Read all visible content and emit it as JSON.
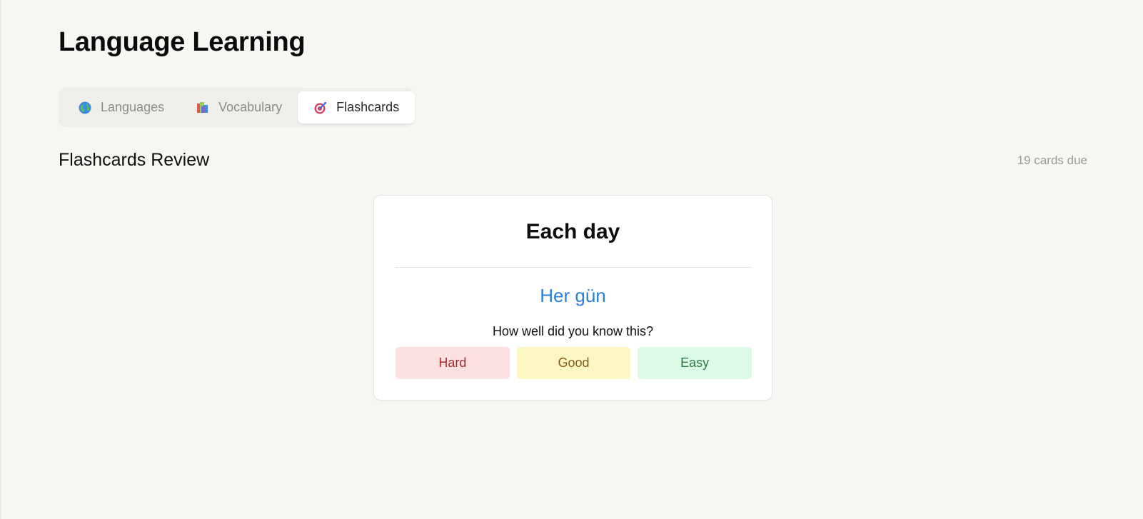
{
  "app": {
    "title": "Language Learning"
  },
  "tabs": [
    {
      "label": "Languages",
      "icon": "globe-icon",
      "active": false
    },
    {
      "label": "Vocabulary",
      "icon": "books-icon",
      "active": false
    },
    {
      "label": "Flashcards",
      "icon": "target-icon",
      "active": true
    }
  ],
  "review": {
    "title": "Flashcards Review",
    "due_text": "19 cards due"
  },
  "card": {
    "front": "Each day",
    "back": "Her gün",
    "prompt": "How well did you know this?"
  },
  "ratings": [
    {
      "label": "Hard",
      "bg": "#fde1e1",
      "fg": "#a22a2a"
    },
    {
      "label": "Good",
      "bg": "#fdf7c4",
      "fg": "#8a5a16"
    },
    {
      "label": "Easy",
      "bg": "#dcfbe7",
      "fg": "#2f7a45"
    }
  ],
  "colors": {
    "background": "#f7f6f3",
    "accent": "#2b7fd9"
  }
}
